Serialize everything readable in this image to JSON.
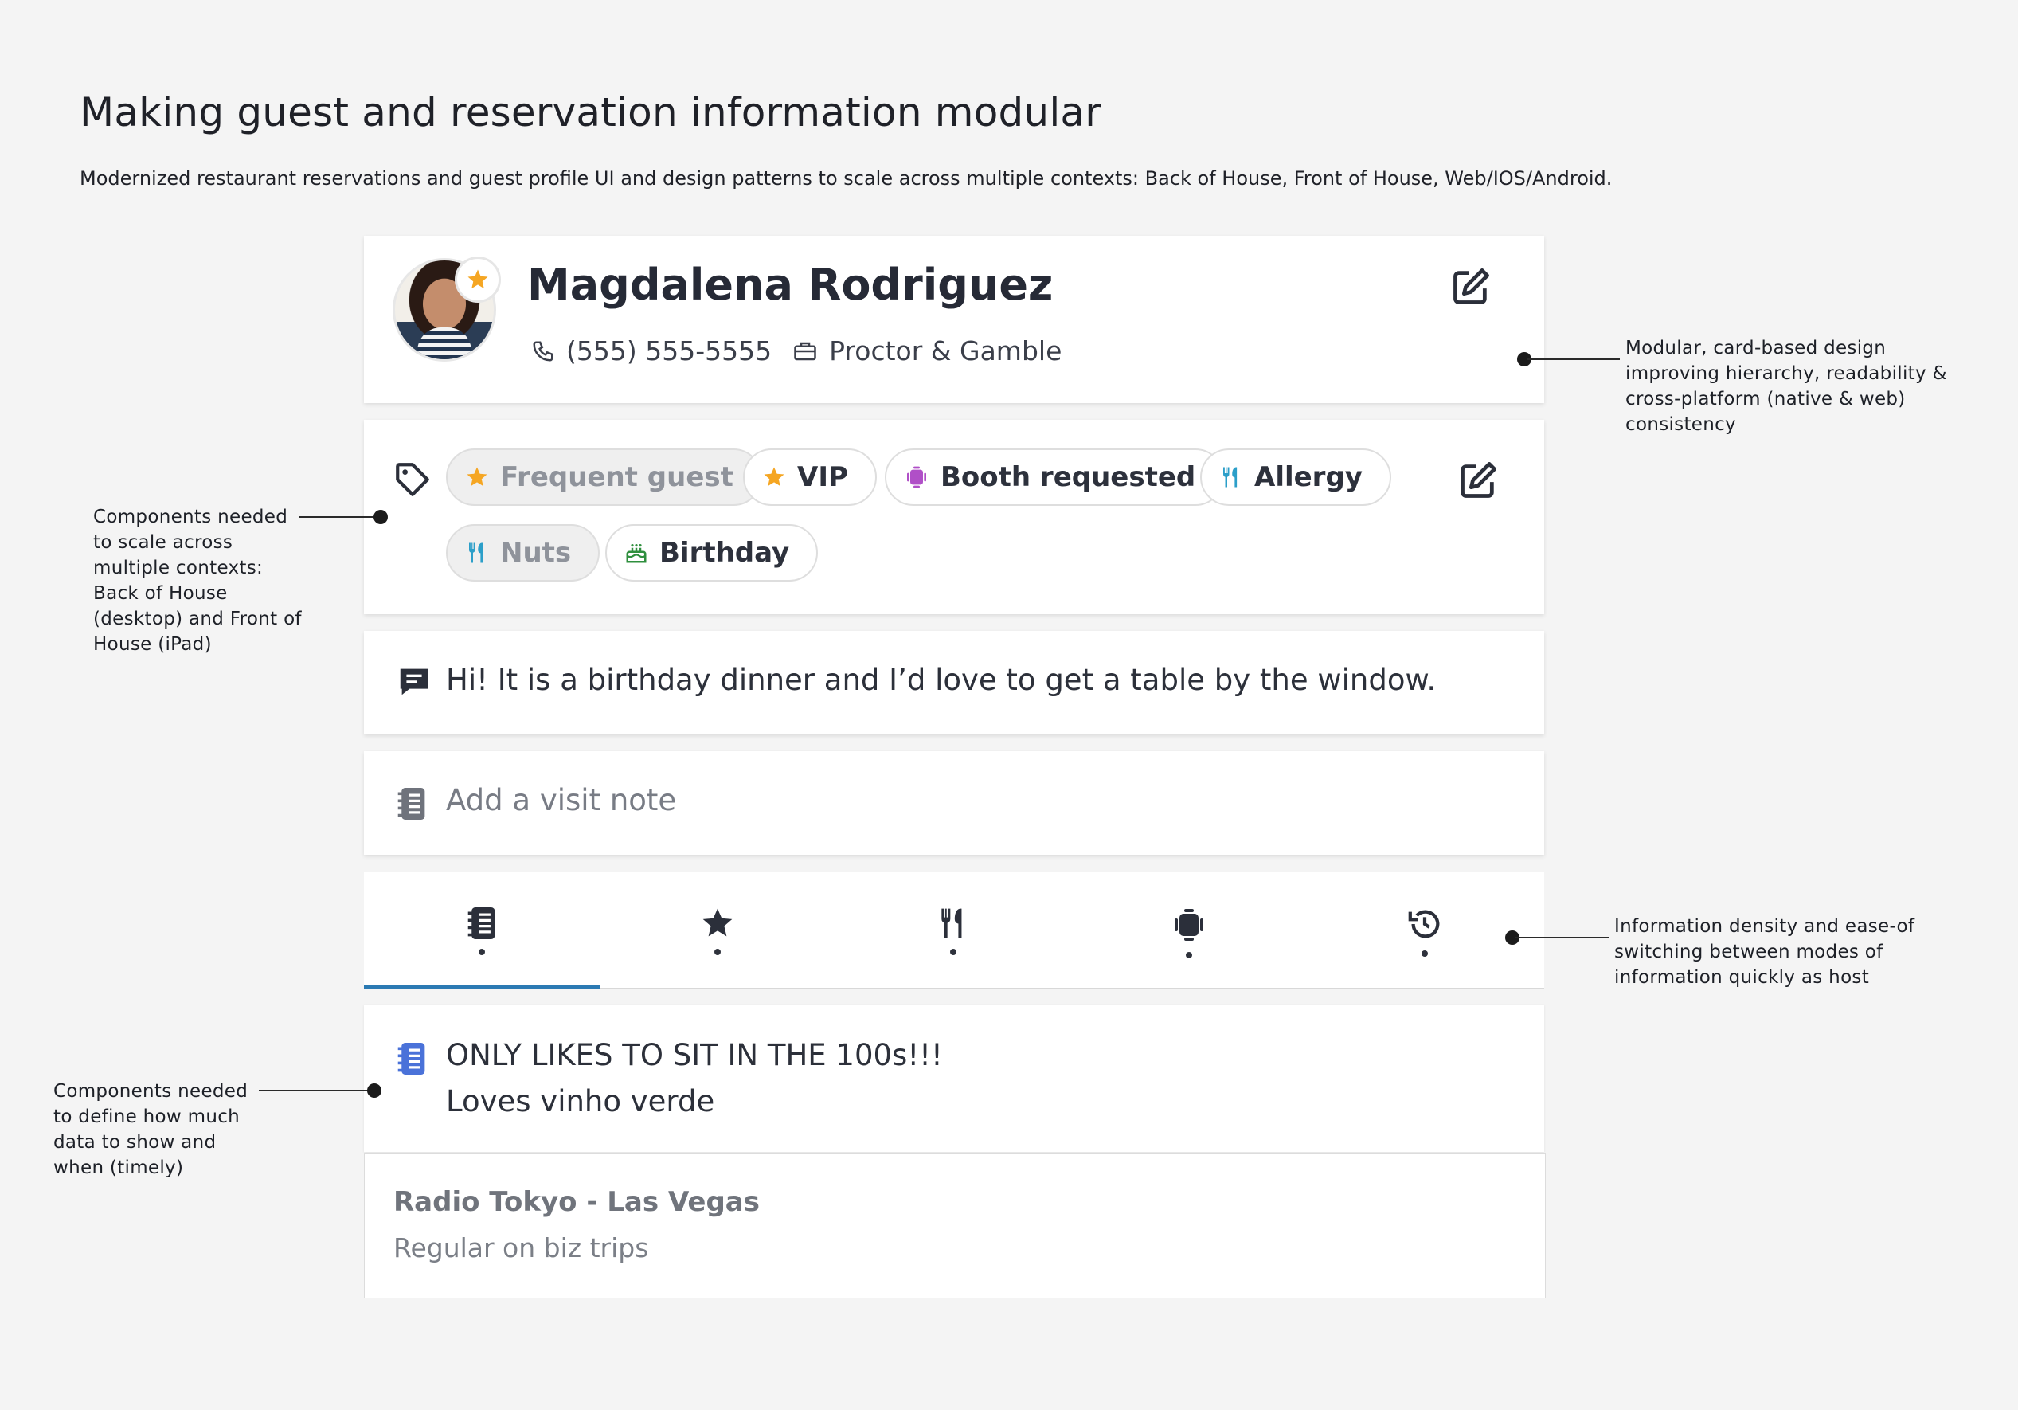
{
  "page": {
    "title": "Making guest and reservation information modular",
    "subtitle": "Modernized restaurant reservations and guest profile UI and design patterns to scale across multiple contexts: Back of House, Front of House, Web/IOS/Android."
  },
  "profile": {
    "name": "Magdalena Rodriguez",
    "phone": "(555) 555-5555",
    "company": "Proctor & Gamble"
  },
  "tags": [
    {
      "label": "Frequent guest",
      "icon": "star-icon",
      "muted": true
    },
    {
      "label": "VIP",
      "icon": "star-icon",
      "muted": false
    },
    {
      "label": "Booth requested",
      "icon": "booth-icon",
      "muted": false
    },
    {
      "label": "Allergy",
      "icon": "utensils-icon",
      "muted": false
    },
    {
      "label": "Nuts",
      "icon": "utensils-icon",
      "muted": true
    },
    {
      "label": "Birthday",
      "icon": "cake-icon",
      "muted": false
    }
  ],
  "message": {
    "text": "Hi! It is a birthday dinner and I’d love to get a table by the window."
  },
  "visit_note": {
    "placeholder": "Add a visit note"
  },
  "tabs": [
    {
      "icon": "notebook-icon",
      "active": true
    },
    {
      "icon": "star-icon",
      "active": false
    },
    {
      "icon": "utensils-icon",
      "active": false
    },
    {
      "icon": "booth-icon",
      "active": false
    },
    {
      "icon": "history-icon",
      "active": false
    }
  ],
  "notes": {
    "line1": "ONLY LIKES TO SIT IN THE 100s!!!",
    "line2": "Loves vinho verde"
  },
  "venue": {
    "title": "Radio Tokyo - Las Vegas",
    "subtitle": "Regular on biz trips"
  },
  "annotations": {
    "right_top": "Modular, card-based design\nimproving hierarchy, readability &\ncross-platform (native & web)\nconsistency",
    "left_top": "Components needed\nto scale across\nmultiple contexts:\nBack of House\n(desktop) and Front of\nHouse (iPad)",
    "right_mid": "Information density and ease-of\nswitching between modes of\ninformation quickly as host",
    "left_bottom": "Components needed\nto define how much\ndata to show and\nwhen (timely)"
  },
  "colors": {
    "star": "#f5a623",
    "booth": "#b04fc7",
    "utensils": "#2c9fc9",
    "cake": "#2f8f3e",
    "note_blue": "#4a72d9",
    "tab_active": "#2b7ab3"
  }
}
